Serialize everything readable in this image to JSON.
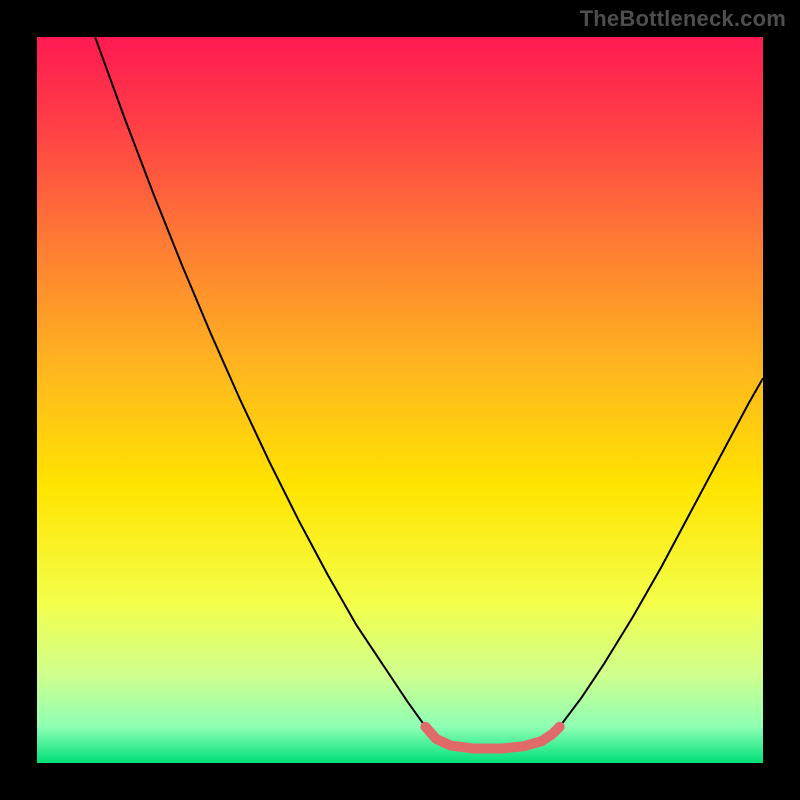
{
  "watermark": "TheBottleneck.com",
  "chart_data": {
    "type": "line",
    "title": "",
    "xlabel": "",
    "ylabel": "",
    "xlim": [
      0,
      100
    ],
    "ylim": [
      0,
      100
    ],
    "background_gradient": {
      "stops": [
        {
          "offset": 0.0,
          "color": "#ff1a52"
        },
        {
          "offset": 0.12,
          "color": "#ff3e46"
        },
        {
          "offset": 0.28,
          "color": "#ff7a35"
        },
        {
          "offset": 0.45,
          "color": "#ffb41f"
        },
        {
          "offset": 0.62,
          "color": "#ffe400"
        },
        {
          "offset": 0.78,
          "color": "#f3ff4a"
        },
        {
          "offset": 0.88,
          "color": "#cfff8f"
        },
        {
          "offset": 0.95,
          "color": "#8effb4"
        },
        {
          "offset": 1.0,
          "color": "#00e07a"
        }
      ]
    },
    "series": [
      {
        "name": "left_curve",
        "stroke": "#000000",
        "stroke_width": 2,
        "points": [
          {
            "x": 8.0,
            "y": 100.0
          },
          {
            "x": 12.0,
            "y": 89.0
          },
          {
            "x": 16.0,
            "y": 78.5
          },
          {
            "x": 20.0,
            "y": 68.5
          },
          {
            "x": 24.0,
            "y": 59.0
          },
          {
            "x": 28.0,
            "y": 50.0
          },
          {
            "x": 32.0,
            "y": 41.5
          },
          {
            "x": 36.0,
            "y": 33.5
          },
          {
            "x": 40.0,
            "y": 26.0
          },
          {
            "x": 44.0,
            "y": 19.0
          },
          {
            "x": 48.0,
            "y": 13.0
          },
          {
            "x": 51.0,
            "y": 8.5
          },
          {
            "x": 53.5,
            "y": 5.0
          }
        ]
      },
      {
        "name": "right_curve",
        "stroke": "#000000",
        "stroke_width": 2,
        "points": [
          {
            "x": 72.0,
            "y": 5.0
          },
          {
            "x": 75.0,
            "y": 9.0
          },
          {
            "x": 78.0,
            "y": 13.5
          },
          {
            "x": 82.0,
            "y": 20.0
          },
          {
            "x": 86.0,
            "y": 27.0
          },
          {
            "x": 90.0,
            "y": 34.5
          },
          {
            "x": 94.0,
            "y": 42.0
          },
          {
            "x": 98.0,
            "y": 49.5
          },
          {
            "x": 100.0,
            "y": 53.0
          }
        ]
      },
      {
        "name": "bottom_highlight",
        "stroke": "#e06a6a",
        "stroke_width": 10,
        "linecap": "round",
        "points": [
          {
            "x": 53.5,
            "y": 5.0
          },
          {
            "x": 55.0,
            "y": 3.3
          },
          {
            "x": 57.0,
            "y": 2.4
          },
          {
            "x": 60.0,
            "y": 2.0
          },
          {
            "x": 64.0,
            "y": 2.0
          },
          {
            "x": 67.0,
            "y": 2.3
          },
          {
            "x": 69.5,
            "y": 3.0
          },
          {
            "x": 71.0,
            "y": 4.0
          },
          {
            "x": 72.0,
            "y": 5.0
          }
        ]
      }
    ]
  }
}
